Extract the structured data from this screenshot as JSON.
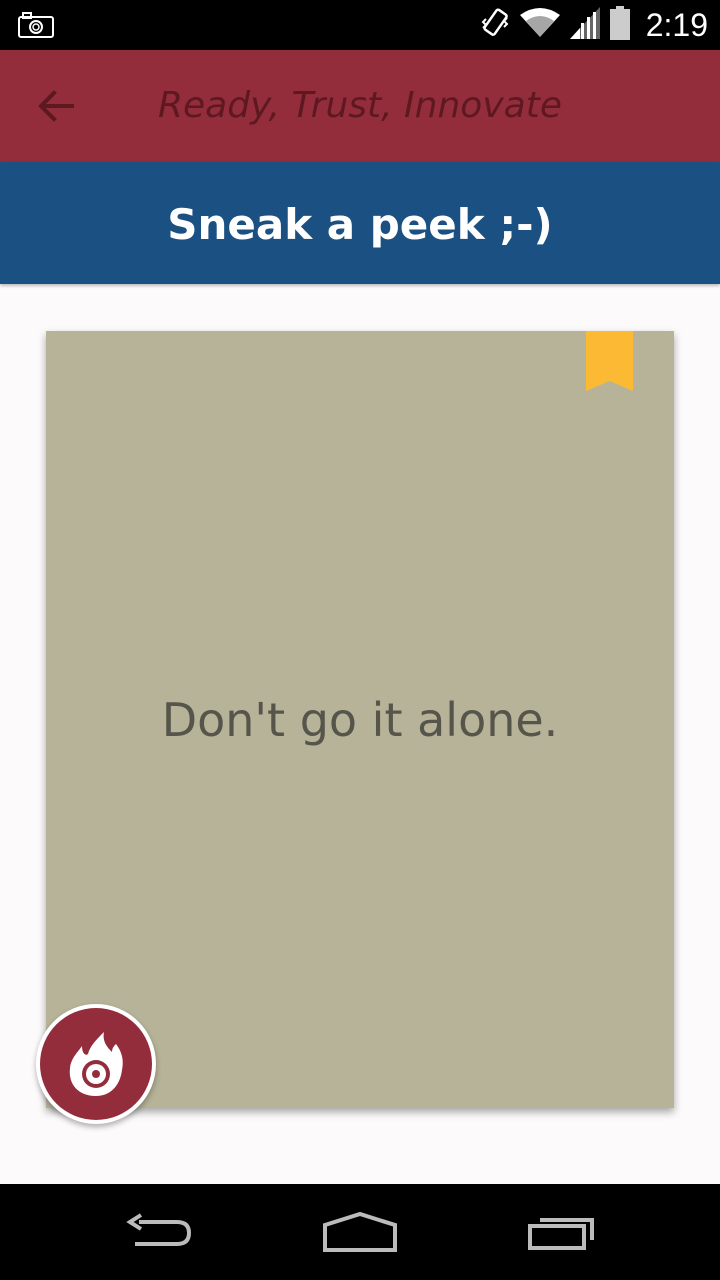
{
  "status_bar": {
    "time": "2:19",
    "icons": [
      "camera-icon",
      "vibrate-icon",
      "wifi-icon",
      "signal-icon",
      "battery-icon"
    ]
  },
  "action_bar": {
    "title": "Ready, Trust, Innovate",
    "back_icon": "back-arrow-icon",
    "color": "#932d3b"
  },
  "section_header": {
    "title": "Sneak a peek ;-)",
    "color": "#1b5082"
  },
  "card": {
    "text": "Don't go it alone.",
    "background": "#b7b398",
    "bookmark_icon": "bookmark-icon",
    "bookmark_color": "#fbb934",
    "fab_icon": "flame-eye-icon"
  },
  "nav_bar": {
    "buttons": [
      "back-icon",
      "home-icon",
      "recent-apps-icon"
    ]
  }
}
